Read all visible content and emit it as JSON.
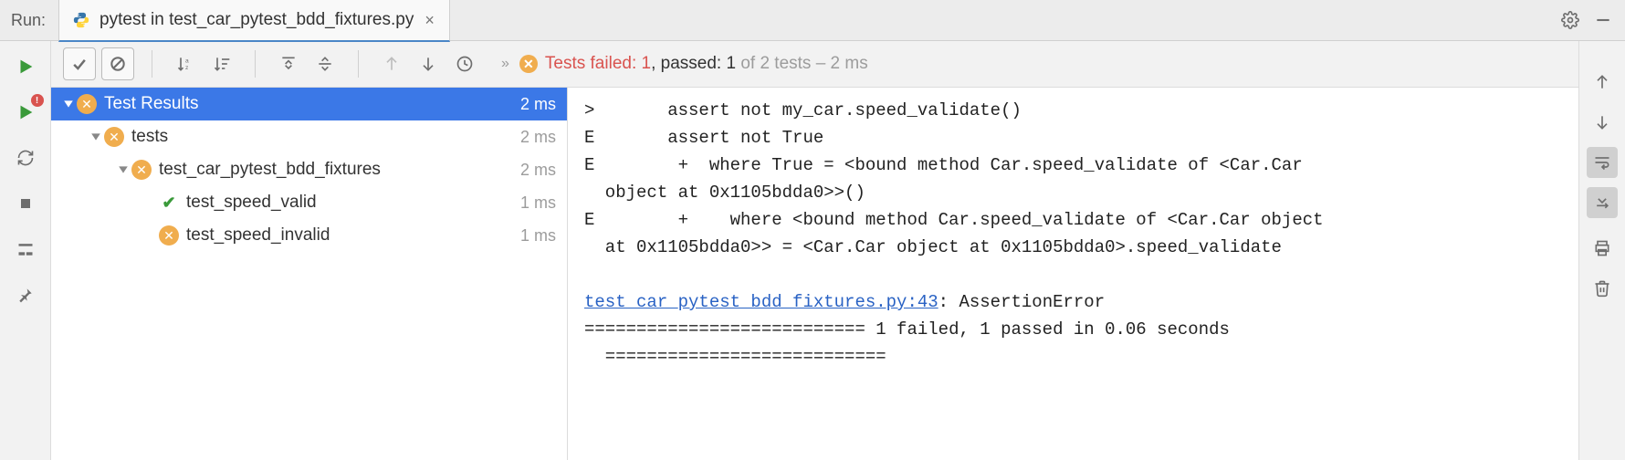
{
  "titlebar": {
    "run_label": "Run:",
    "tab_label": "pytest in test_car_pytest_bdd_fixtures.py"
  },
  "status": {
    "failed_label": "Tests failed: ",
    "failed_count": "1",
    "passed_label": ", passed: ",
    "passed_count": "1",
    "tail": " of 2 tests – 2 ms"
  },
  "tree": {
    "root": {
      "label": "Test Results",
      "time": "2 ms"
    },
    "n1": {
      "label": "tests",
      "time": "2 ms"
    },
    "n2": {
      "label": "test_car_pytest_bdd_fixtures",
      "time": "2 ms"
    },
    "n3": {
      "label": "test_speed_valid",
      "time": "1 ms"
    },
    "n4": {
      "label": "test_speed_invalid",
      "time": "1 ms"
    }
  },
  "console": {
    "l1": ">       assert not my_car.speed_validate()",
    "l2": "E       assert not True",
    "l3": "E        +  where True = <bound method Car.speed_validate of <Car.Car",
    "l4": "  object at 0x1105bdda0>>()",
    "l5": "E        +    where <bound method Car.speed_validate of <Car.Car object",
    "l6": "  at 0x1105bdda0>> = <Car.Car object at 0x1105bdda0>.speed_validate",
    "l7": "",
    "link": "test_car_pytest_bdd_fixtures.py:43",
    "l8_tail": ": AssertionError",
    "l9": "=========================== 1 failed, 1 passed in 0.06 seconds",
    "l10": "  ==========================="
  }
}
